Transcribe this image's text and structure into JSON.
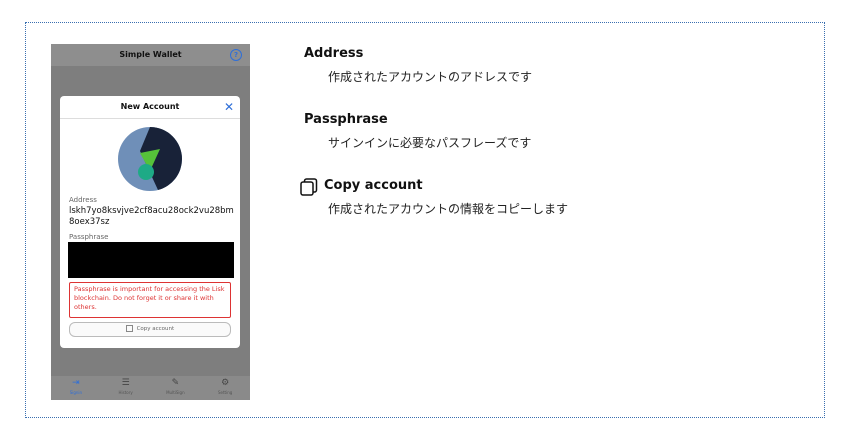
{
  "phone": {
    "app_title": "Simple Wallet",
    "help_icon": "?",
    "modal": {
      "title": "New Account",
      "close_icon": "✕",
      "address_label": "Address",
      "address_value": "lskh7yo8ksvjve2cf8acu28ock2vu28bm8oex37sz",
      "passphrase_label": "Passphrase",
      "warning": "Passphrase is important for accessing the Lisk blockchain. Do not forget it or share it with others.",
      "copy_button": "Copy account"
    },
    "tabs": [
      {
        "label": "Signin",
        "icon": "signin-icon"
      },
      {
        "label": "History",
        "icon": "list-icon"
      },
      {
        "label": "MultiSign",
        "icon": "edit-icon"
      },
      {
        "label": "Setting",
        "icon": "gear-icon"
      }
    ]
  },
  "descriptions": {
    "address": {
      "title": "Address",
      "text": "作成されたアカウントのアドレスです"
    },
    "passphrase": {
      "title": "Passphrase",
      "text": "サインインに必要なパスフレーズです"
    },
    "copy": {
      "title": "Copy account",
      "text": "作成されたアカウントの情報をコピーします"
    }
  },
  "colors": {
    "accent": "#2f6fd8",
    "warning": "#dd3333",
    "frame_border": "#3a6fb0"
  }
}
